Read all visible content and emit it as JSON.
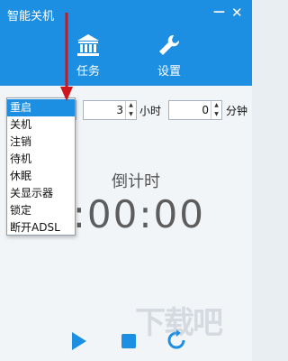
{
  "window": {
    "title": "智能关机",
    "minimize": "—",
    "close": "✕"
  },
  "toolbar": {
    "tasks_label": "任务",
    "settings_label": "设置"
  },
  "action_select": {
    "value": "重启",
    "options": [
      "重启",
      "关机",
      "注销",
      "待机",
      "休眠",
      "关显示器",
      "锁定",
      "断开ADSL"
    ]
  },
  "hours": {
    "value": "3",
    "unit": "小时"
  },
  "minutes": {
    "value": "0",
    "unit": "分钟"
  },
  "countdown": {
    "label": "倒计时",
    "time": "0:00:00"
  },
  "watermark": "下载吧",
  "colors": {
    "accent": "#1c8fe2",
    "annotation_arrow": "#d0161d"
  },
  "icons": {
    "tasks": "bank-icon",
    "settings": "wrench-icon",
    "play": "play-icon",
    "stop": "stop-icon",
    "refresh": "refresh-icon"
  }
}
